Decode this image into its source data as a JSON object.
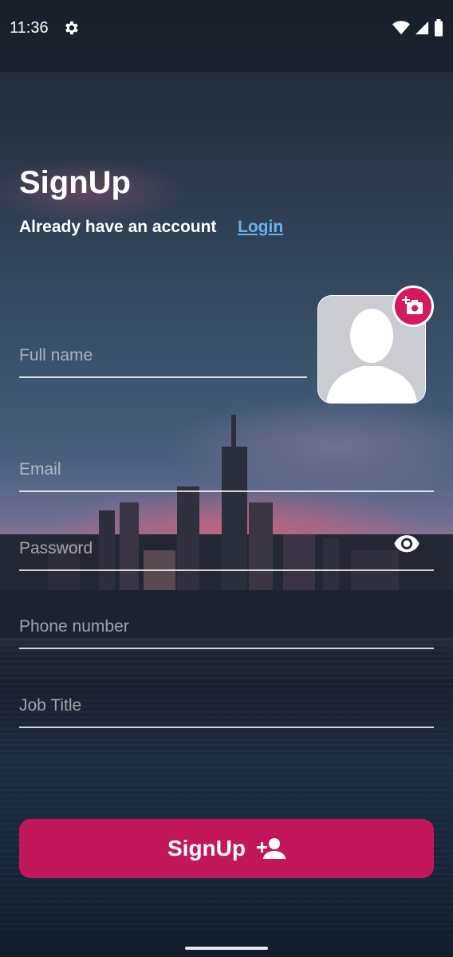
{
  "status_bar": {
    "time": "11:36",
    "icons": [
      "gear-icon",
      "wifi-icon",
      "signal-icon",
      "battery-icon"
    ]
  },
  "header": {
    "title": "SignUp",
    "subtitle": "Already have an account",
    "login_link": "Login"
  },
  "form": {
    "full_name_placeholder": "Full name",
    "email_placeholder": "Email",
    "password_placeholder": "Password",
    "phone_placeholder": "Phone number",
    "job_title_placeholder": "Job Title"
  },
  "avatar": {
    "icon": "person-silhouette-icon",
    "add_photo_icon": "add-a-photo-icon"
  },
  "submit": {
    "label": "SignUp",
    "icon": "person-add-icon"
  },
  "colors": {
    "accent": "#c2185b",
    "link": "#68b3ee",
    "camera_badge": "#d6185e"
  }
}
